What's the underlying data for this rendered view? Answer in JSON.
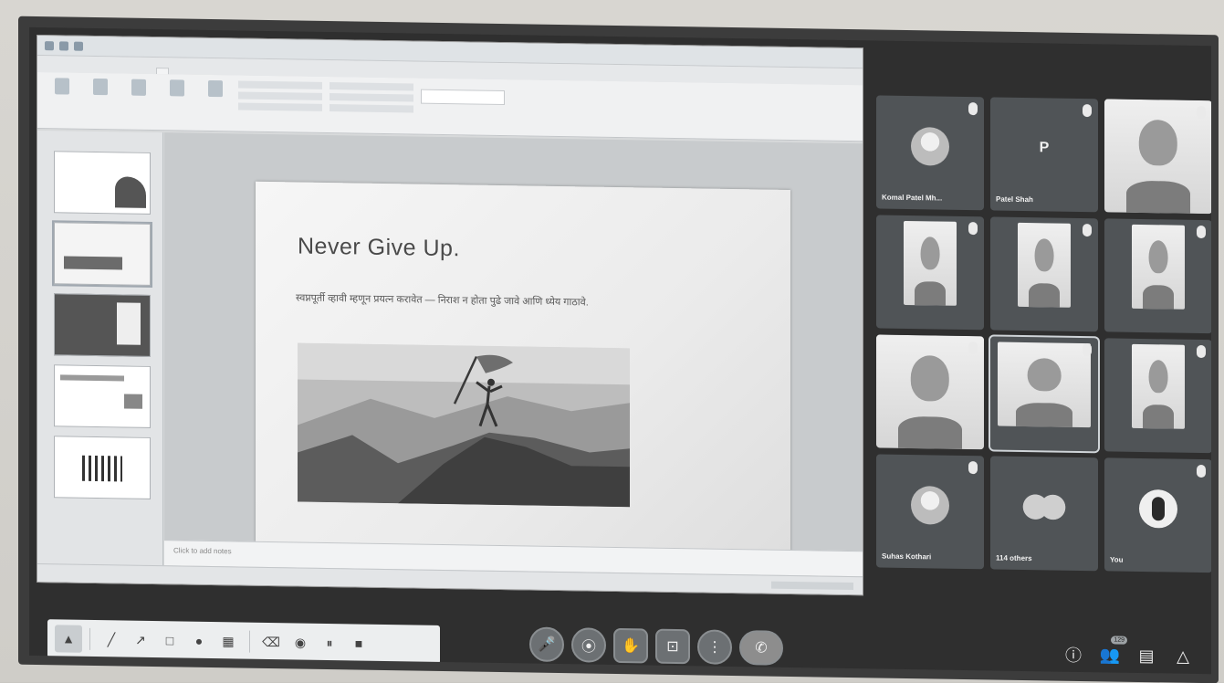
{
  "slide": {
    "title": "Never Give Up.",
    "body": "स्वप्नपूर्ती व्हावी म्हणून प्रयत्न करावेत — निराश न होता पुढे जावे आणि ध्येय गाठावे.",
    "notes_placeholder": "Click to add notes"
  },
  "participants": [
    {
      "name": "Komal Patel Mh...",
      "kind": "photo-avatar"
    },
    {
      "name": "Patel Shah",
      "kind": "letter",
      "letter": "P"
    },
    {
      "name": "",
      "kind": "video-full"
    },
    {
      "name": "",
      "kind": "video"
    },
    {
      "name": "",
      "kind": "video"
    },
    {
      "name": "",
      "kind": "video"
    },
    {
      "name": "",
      "kind": "video-full"
    },
    {
      "name": "",
      "kind": "video",
      "speaking": true
    },
    {
      "name": "",
      "kind": "video"
    },
    {
      "name": "Suhas Kothari",
      "kind": "photo-avatar"
    },
    {
      "name": "114 others",
      "kind": "dual"
    },
    {
      "name": "You",
      "kind": "dark"
    }
  ],
  "annotation_tools": {
    "pointer": "▲",
    "pen": "╱",
    "arrow": "↗",
    "rect": "□",
    "color": "●",
    "fill": "▦",
    "eraser": "⌫",
    "stamp": "◉",
    "pause": "⏸",
    "stop": "■"
  },
  "controls": {
    "mic": "🎤",
    "camera": "⦿",
    "hand": "✋",
    "present": "⊡",
    "more": "⋮",
    "end": "✆"
  },
  "right_controls": {
    "info": "ⓘ",
    "people": "👥",
    "people_badge": "129",
    "chat": "▤",
    "activities": "△"
  }
}
